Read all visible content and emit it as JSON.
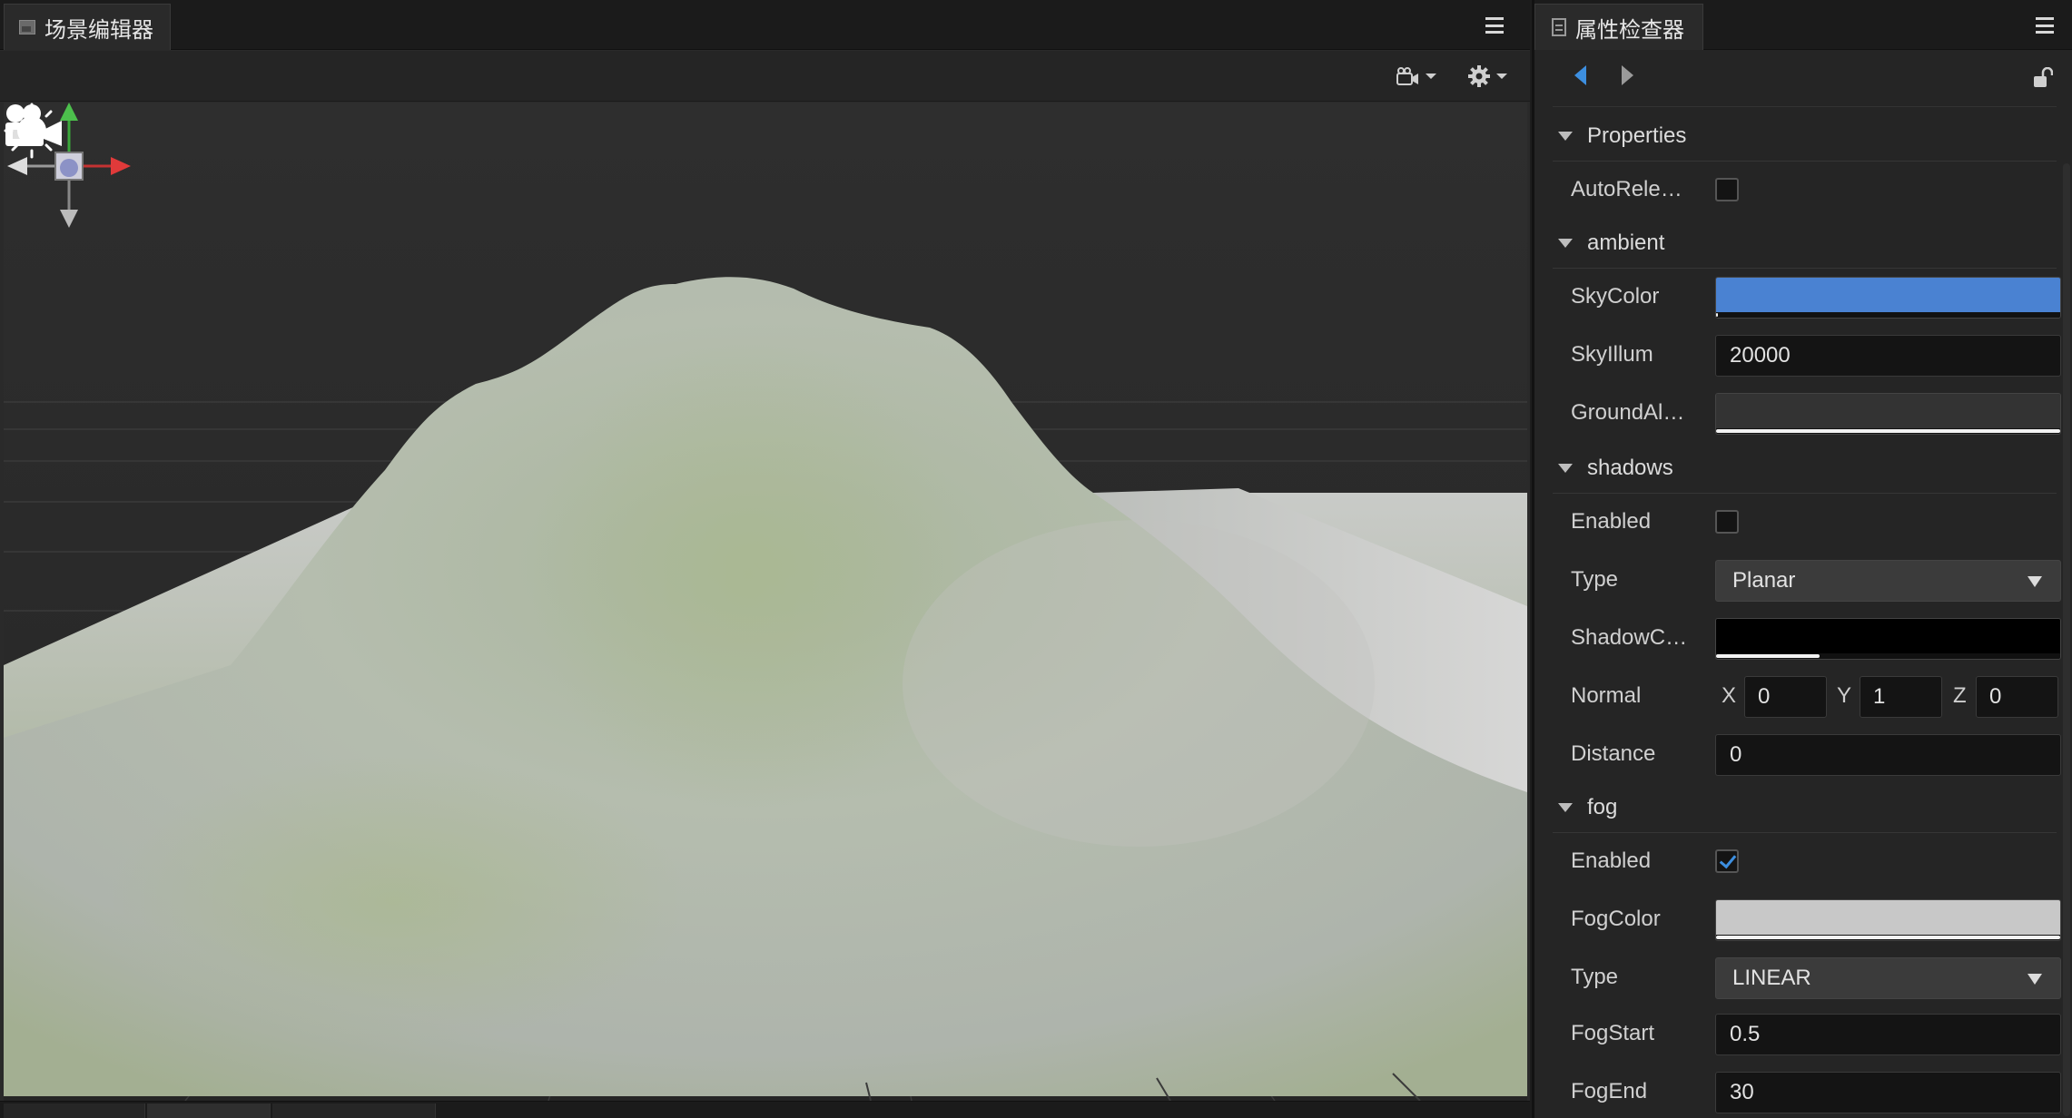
{
  "scene_editor": {
    "tab_title": "场景编辑器"
  },
  "inspector": {
    "tab_title": "属性检查器",
    "sections": {
      "properties": "Properties",
      "ambient": "ambient",
      "shadows": "shadows",
      "fog": "fog"
    },
    "properties": {
      "auto_release_label": "AutoRele…",
      "auto_release_checked": false
    },
    "ambient": {
      "sky_color_label": "SkyColor",
      "sky_color": "#4a82d2",
      "sky_illum_label": "SkyIllum",
      "sky_illum": "20000",
      "ground_albedo_label": "GroundAl…",
      "ground_albedo_color": "#333333"
    },
    "shadows": {
      "enabled_label": "Enabled",
      "enabled_checked": false,
      "type_label": "Type",
      "type_value": "Planar",
      "shadow_color_label": "ShadowC…",
      "shadow_color": "#000000",
      "normal_label": "Normal",
      "normal_x_label": "X",
      "normal_x": "0",
      "normal_y_label": "Y",
      "normal_y": "1",
      "normal_z_label": "Z",
      "normal_z": "0",
      "distance_label": "Distance",
      "distance": "0"
    },
    "fog": {
      "enabled_label": "Enabled",
      "enabled_checked": true,
      "fog_color_label": "FogColor",
      "fog_color": "#c8c8c8",
      "type_label": "Type",
      "type_value": "LINEAR",
      "fog_start_label": "FogStart",
      "fog_start": "0.5",
      "fog_end_label": "FogEnd",
      "fog_end": "30"
    }
  },
  "icons": [
    "scene-tab-icon",
    "menu-icon",
    "camera-view-icon",
    "gear-icon",
    "transform-gizmo-icon",
    "camera-icon",
    "sun-light-icon",
    "document-icon",
    "back-arrow-icon",
    "forward-arrow-icon",
    "lock-icon"
  ]
}
